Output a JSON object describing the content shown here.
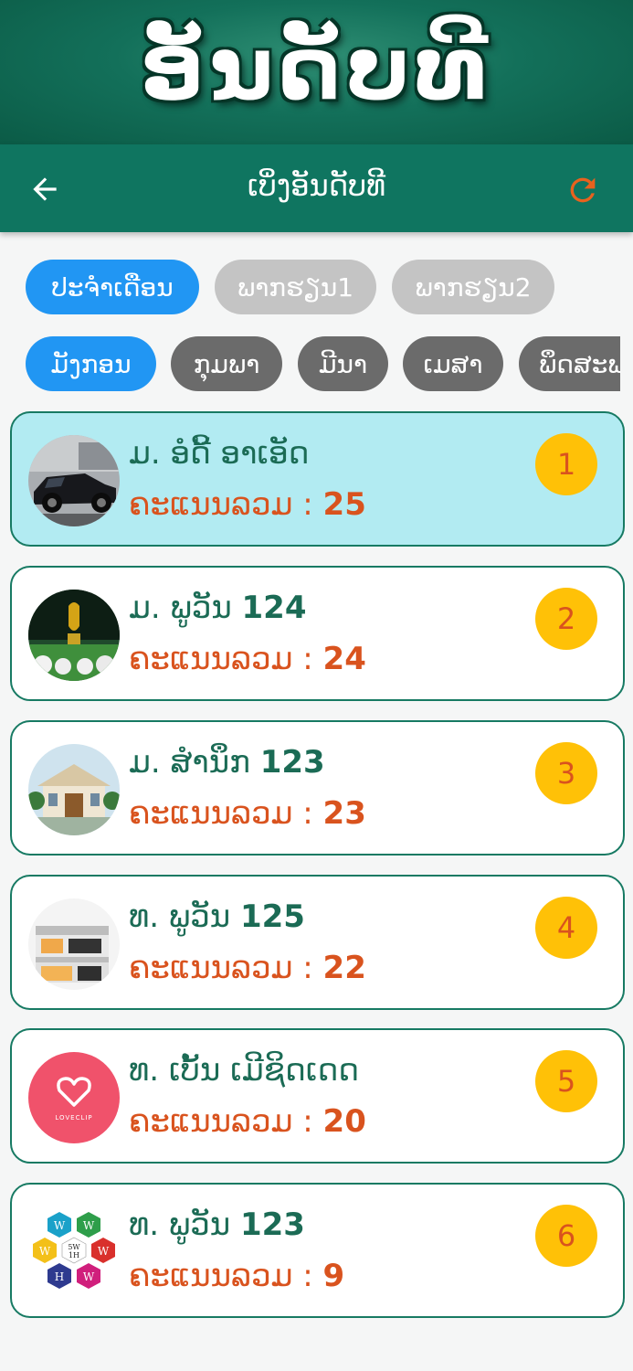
{
  "banner": {
    "title": "ອັນດັບທີ"
  },
  "appbar": {
    "title": "ເບິ່ງອັນດັບທີ",
    "back_icon": "arrow-left-icon",
    "refresh_icon": "refresh-icon"
  },
  "filters": {
    "periods": [
      "ປະຈຳເດືອນ",
      "ພາກຮຽນ1",
      "ພາກຮຽນ2"
    ],
    "selected_period": "ປະຈຳເດືອນ",
    "months": [
      "ມັງກອນ",
      "ກຸມພາ",
      "ມີນາ",
      "ເມສາ",
      "ພຶດສະພາ"
    ],
    "selected_month": "ມັງກອນ"
  },
  "ranking": [
    {
      "prefix": "ມ. ອໍດີ້ ອາເອັດ",
      "num": "",
      "score_label": "ຄະແນນລວມ : ",
      "score": "25",
      "rank": "1",
      "avatar": "car"
    },
    {
      "prefix": "ມ. ພູວັນ ",
      "num": "124",
      "score_label": "ຄະແນນລວມ : ",
      "score": "24",
      "rank": "2",
      "avatar": "trophy"
    },
    {
      "prefix": "ມ. ສຳນຶກ ",
      "num": "123",
      "score_label": "ຄະແນນລວມ : ",
      "score": "23",
      "rank": "3",
      "avatar": "mansion"
    },
    {
      "prefix": "ທ. ພູວັນ ",
      "num": "125",
      "score_label": "ຄະແນນລວມ : ",
      "score": "22",
      "rank": "4",
      "avatar": "house"
    },
    {
      "prefix": "ທ. ເບັ້ນ ເມີຊິດເດດ",
      "num": "",
      "score_label": "ຄະແນນລວມ : ",
      "score": "20",
      "rank": "5",
      "avatar": "loveclip",
      "avatar_text": "LOVECLIP"
    },
    {
      "prefix": "ທ. ພູວັນ ",
      "num": "123",
      "score_label": "ຄະແນນລວມ : ",
      "score": "9",
      "rank": "6",
      "avatar": "5w1h",
      "avatar_text": [
        "W",
        "W",
        "W",
        "5W",
        "1H",
        "W",
        "H",
        "W"
      ]
    }
  ],
  "colors": {
    "primary": "#0f7560",
    "accent": "#d9531e",
    "chip_selected": "#2196f3",
    "rank_badge": "#ffc107",
    "highlight": "#b2ebf2"
  }
}
